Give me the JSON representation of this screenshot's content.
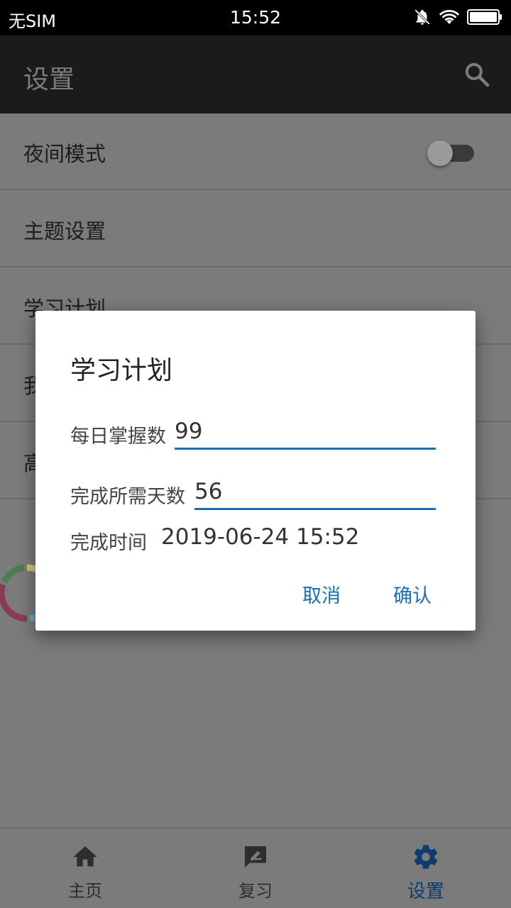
{
  "status_bar": {
    "carrier": "无SIM",
    "time": "15:52",
    "icons": [
      "mute-icon",
      "wifi-icon",
      "battery-icon"
    ]
  },
  "app_bar": {
    "title": "设置",
    "search_icon": "search-icon"
  },
  "settings": {
    "items": [
      {
        "label": "夜间模式",
        "toggle": false
      },
      {
        "label": "主题设置"
      },
      {
        "label": "学习计划"
      },
      {
        "label": "我"
      },
      {
        "label": "高"
      }
    ]
  },
  "dialog": {
    "title": "学习计划",
    "daily_label": "每日掌握数",
    "daily_value": "99",
    "days_label": "完成所需天数",
    "days_value": "56",
    "finish_label": "完成时间",
    "finish_value": "2019-06-24 15:52",
    "cancel": "取消",
    "confirm": "确认"
  },
  "bottom_nav": {
    "items": [
      {
        "label": "主页",
        "icon": "home-icon",
        "active": false
      },
      {
        "label": "复习",
        "icon": "review-icon",
        "active": false
      },
      {
        "label": "设置",
        "icon": "gear-icon",
        "active": true
      }
    ]
  },
  "colors": {
    "accent": "#1a6fb4",
    "active_nav": "#0d3c6d",
    "app_bar": "#1b1b1b"
  }
}
